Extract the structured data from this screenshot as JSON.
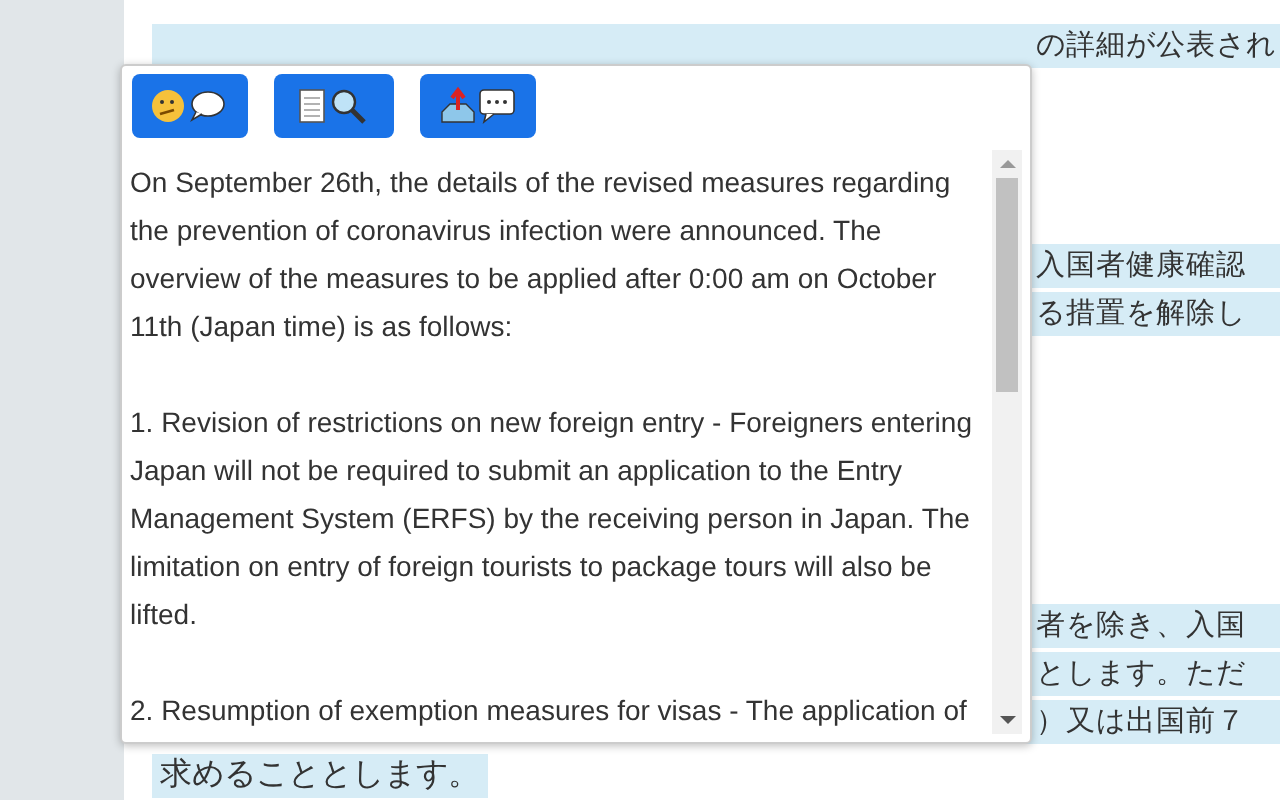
{
  "page_lines": [
    {
      "text": "の詳細が公表され"
    },
    {
      "text": "入国者健康確認"
    },
    {
      "text": "る措置を解除し"
    },
    {
      "text": "者を除き、入国"
    },
    {
      "text": "とします。ただ"
    },
    {
      "text": "）又は出国前７"
    },
    {
      "text": "求めることとします。"
    }
  ],
  "popup": {
    "buttons": [
      {
        "kind": "explain"
      },
      {
        "kind": "lookup"
      },
      {
        "kind": "share"
      }
    ],
    "paragraphs": [
      "On September 26th, the details of the revised measures regarding the prevention of coronavirus infection were announced. The overview of the measures to be applied after 0:00 am on October 11th (Japan time) is as follows:",
      "1. Revision of restrictions on new foreign entry - Foreigners entering Japan will not be required to submit an application to the Entry Management System (ERFS) by the receiving person in Japan. The limitation on entry of foreign tourists to package tours will also be lifted.",
      "2. Resumption of exemption measures for visas - The application of"
    ]
  }
}
